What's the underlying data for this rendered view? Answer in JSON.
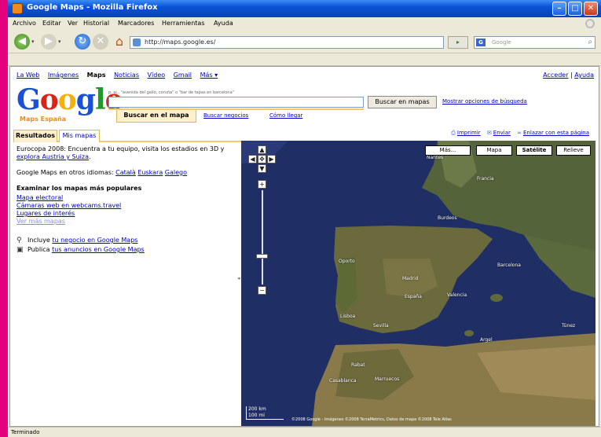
{
  "window": {
    "title": "Google Maps - Mozilla Firefox",
    "minimize": "–",
    "maximize": "□",
    "close": "✕"
  },
  "menubar": {
    "items": [
      "Archivo",
      "Editar",
      "Ver",
      "Historial",
      "Marcadores",
      "Herramientas",
      "Ayuda"
    ]
  },
  "navbar": {
    "url": "http://maps.google.es/",
    "go_label": "▸",
    "search_engine_icon": "G",
    "search_placeholder": "Google",
    "back_icon": "back-arrow-icon",
    "forward_icon": "forward-arrow-icon",
    "reload_icon": "reload-icon",
    "stop_icon": "stop-icon",
    "home_icon": "home-icon"
  },
  "topnav": {
    "items": [
      "La Web",
      "Imágenes",
      "Maps",
      "Noticias",
      "Vídeo",
      "Gmail",
      "Más ▾"
    ],
    "signin": "Acceder",
    "separator": "|",
    "help": "Ayuda"
  },
  "logo": {
    "letters": [
      "G",
      "o",
      "o",
      "g",
      "l",
      "e"
    ],
    "subtitle": "Maps España"
  },
  "search": {
    "example": "p. ej., \"avenida del gallo, coruña\" o \"bar de tapas en barcelona\"",
    "value": "",
    "button": "Buscar en mapas",
    "advanced": "Mostrar opciones de búsqueda",
    "tab_search_map": "Buscar en el mapa",
    "tab_business": "Buscar negocios",
    "tab_directions": "Cómo llegar"
  },
  "results_tabs": {
    "results": "Resultados",
    "my_maps": "Mis mapas"
  },
  "map_actions": {
    "print": "Imprimir",
    "send": "Enviar",
    "link": "Enlazar con esta página"
  },
  "left_panel": {
    "promo_text": "Eurocopa 2008: Encuentra a tu equipo, visita los estadios en 3D y ",
    "promo_link": "explora Austria y Suiza",
    "promo_end": ".",
    "languages_intro": "Google Maps en otros idiomas: ",
    "languages": [
      "Català",
      "Euskara",
      "Galego"
    ],
    "popular_title": "Examinar los mapas más populares",
    "popular_links": [
      "Mapa electoral",
      "Cámaras web en webcams.travel",
      "Lugares de interés"
    ],
    "popular_more": "Ver más mapas",
    "business_prefix": "Incluye ",
    "business_link": "tu negocio en Google Maps",
    "ads_prefix": "Publica ",
    "ads_link": "tus anuncios en Google Maps"
  },
  "map": {
    "type_buttons": [
      "Más...",
      "Mapa",
      "Satélite",
      "Relieve"
    ],
    "pan": {
      "n": "▲",
      "w": "◀",
      "c": "✥",
      "e": "▶",
      "s": "▼"
    },
    "zoom_in": "+",
    "zoom_out": "−",
    "zoom_level": 0.71,
    "places": [
      "Nantes",
      "Francia",
      "Burdeos",
      "Oporto",
      "España",
      "Madrid",
      "Lisboa",
      "Sevilla",
      "Barcelona",
      "Valencia",
      "Argel",
      "Marruecos",
      "Casablanca",
      "Rabat",
      "Túnez"
    ],
    "scale_km": "200 km",
    "scale_mi": "100 mi",
    "copyright": "©2008 Google - Imágenes ©2008 TerraMetrics, Datos de mapa ©2008 Tele Atlas"
  },
  "status": {
    "text": "Terminado"
  },
  "colors": {
    "pink_strip": "#e5007e",
    "ocean": "#1f2f66",
    "land": "#5a6a3a",
    "link": "#0000cc"
  }
}
